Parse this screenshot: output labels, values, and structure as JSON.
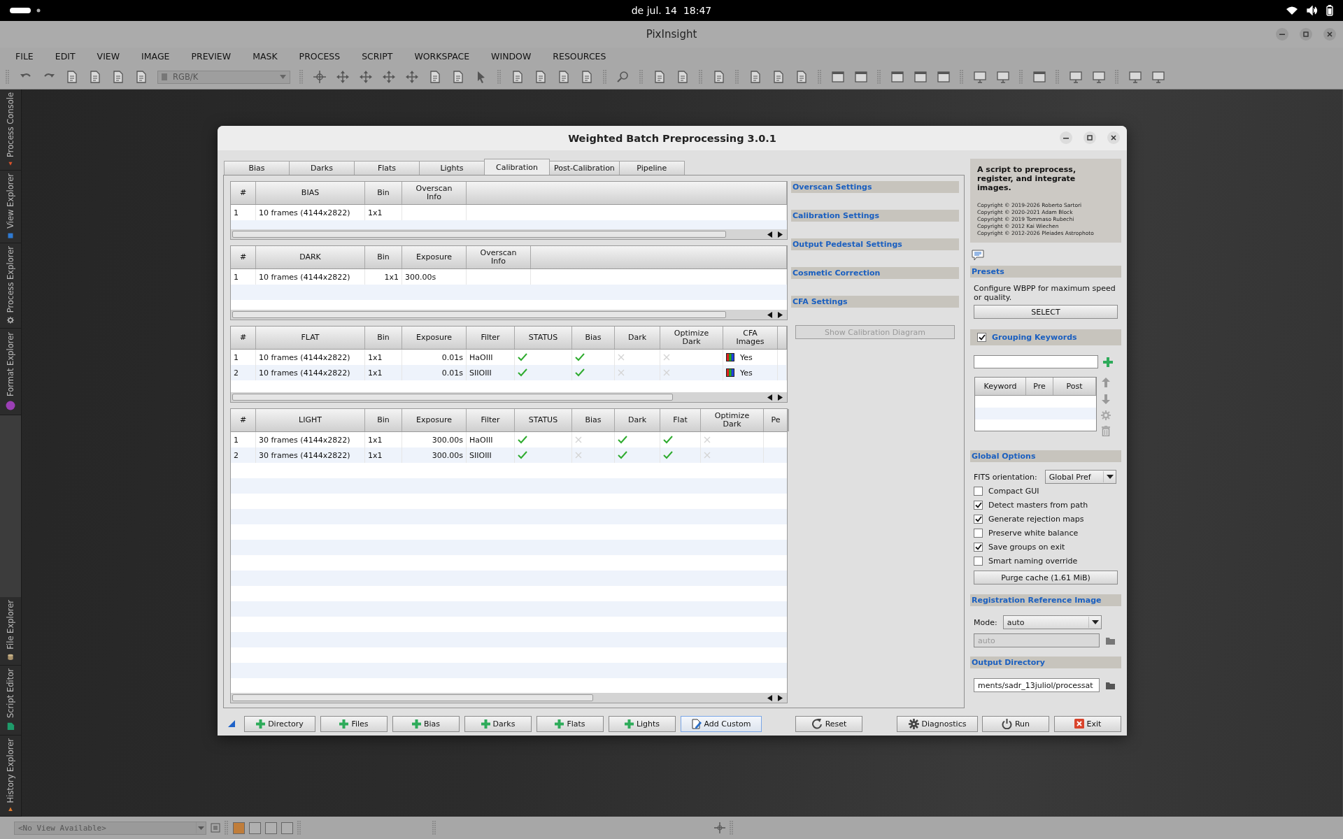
{
  "system_bar": {
    "clock": "de jul. 14  18:47"
  },
  "app": {
    "title": "PixInsight"
  },
  "menu": [
    {
      "label": "FILE"
    },
    {
      "label": "EDIT"
    },
    {
      "label": "VIEW"
    },
    {
      "label": "IMAGE"
    },
    {
      "label": "PREVIEW"
    },
    {
      "label": "MASK"
    },
    {
      "label": "PROCESS"
    },
    {
      "label": "SCRIPT"
    },
    {
      "label": "WORKSPACE"
    },
    {
      "label": "WINDOW"
    },
    {
      "label": "RESOURCES"
    }
  ],
  "toolbar": {
    "color_space": {
      "value": "RGB/K",
      "disabled": true
    }
  },
  "dock_tabs": [
    {
      "label": "Process Console"
    },
    {
      "label": "View Explorer"
    },
    {
      "label": "Process Explorer"
    },
    {
      "label": "Format Explorer"
    },
    {
      "label": "File Explorer"
    },
    {
      "label": "Script Editor"
    },
    {
      "label": "History Explorer"
    }
  ],
  "dialog": {
    "title": "Weighted Batch Preprocessing 3.0.1",
    "tabs": [
      {
        "label": "Bias",
        "selected": false
      },
      {
        "label": "Darks",
        "selected": false
      },
      {
        "label": "Flats",
        "selected": false
      },
      {
        "label": "Lights",
        "selected": false
      },
      {
        "label": "Calibration",
        "selected": true
      },
      {
        "label": "Post-Calibration",
        "selected": false
      },
      {
        "label": "Pipeline",
        "selected": false
      }
    ],
    "tables": [
      {
        "columns": [
          "#",
          "BIAS",
          "Bin",
          "Overscan Info"
        ],
        "rows": [
          [
            {
              "kind": "text",
              "text": "1"
            },
            {
              "kind": "text",
              "text": "10 frames (4144x2822)"
            },
            {
              "kind": "text",
              "text": "1x1"
            }
          ]
        ]
      },
      {
        "columns": [
          "#",
          "DARK",
          "Bin",
          "Exposure",
          "Overscan Info"
        ],
        "rows": [
          [
            {
              "kind": "text",
              "text": "1"
            },
            {
              "kind": "text",
              "text": "10 frames (4144x2822)"
            },
            {
              "kind": "number",
              "text": "1x1"
            },
            {
              "kind": "text",
              "text": "300.00s"
            }
          ]
        ]
      },
      {
        "columns": [
          "#",
          "FLAT",
          "Bin",
          "Exposure",
          "Filter",
          "STATUS",
          "Bias",
          "Dark",
          "Optimize Dark",
          "CFA Images"
        ],
        "rows": [
          [
            {
              "kind": "text",
              "text": "1"
            },
            {
              "kind": "text",
              "text": "10 frames (4144x2822)"
            },
            {
              "kind": "text",
              "text": "1x1"
            },
            {
              "kind": "number",
              "text": "0.01s"
            },
            {
              "kind": "text",
              "text": "HaOIII"
            },
            {
              "kind": "check",
              "checked": true
            },
            {
              "kind": "check",
              "checked": true
            },
            {
              "kind": "check",
              "checked": false
            },
            {
              "kind": "check",
              "checked": false
            },
            {
              "kind": "cfa",
              "text": "Yes"
            }
          ],
          [
            {
              "kind": "text",
              "text": "2"
            },
            {
              "kind": "text",
              "text": "10 frames (4144x2822)"
            },
            {
              "kind": "text",
              "text": "1x1"
            },
            {
              "kind": "number",
              "text": "0.01s"
            },
            {
              "kind": "text",
              "text": "SIIOIII"
            },
            {
              "kind": "check",
              "checked": true
            },
            {
              "kind": "check",
              "checked": true
            },
            {
              "kind": "check",
              "checked": false
            },
            {
              "kind": "check",
              "checked": false
            },
            {
              "kind": "cfa",
              "text": "Yes"
            }
          ]
        ]
      },
      {
        "columns": [
          "#",
          "LIGHT",
          "Bin",
          "Exposure",
          "Filter",
          "STATUS",
          "Bias",
          "Dark",
          "Flat",
          "Optimize Dark",
          "Pe"
        ],
        "rows": [
          [
            {
              "kind": "text",
              "text": "1"
            },
            {
              "kind": "text",
              "text": "30 frames (4144x2822)"
            },
            {
              "kind": "text",
              "text": "1x1"
            },
            {
              "kind": "number",
              "text": "300.00s"
            },
            {
              "kind": "text",
              "text": "HaOIII"
            },
            {
              "kind": "check",
              "checked": true
            },
            {
              "kind": "check",
              "checked": false
            },
            {
              "kind": "check",
              "checked": true
            },
            {
              "kind": "check",
              "checked": true
            },
            {
              "kind": "check",
              "checked": false
            }
          ],
          [
            {
              "kind": "text",
              "text": "2"
            },
            {
              "kind": "text",
              "text": "30 frames (4144x2822)"
            },
            {
              "kind": "text",
              "text": "1x1"
            },
            {
              "kind": "number",
              "text": "300.00s"
            },
            {
              "kind": "text",
              "text": "SIIOIII"
            },
            {
              "kind": "check",
              "checked": true
            },
            {
              "kind": "check",
              "checked": false
            },
            {
              "kind": "check",
              "checked": true
            },
            {
              "kind": "check",
              "checked": true
            },
            {
              "kind": "check",
              "checked": false
            }
          ]
        ]
      }
    ],
    "sections": [
      "Overscan Settings",
      "Calibration Settings",
      "Output Pedestal Settings",
      "Cosmetic Correction",
      "CFA Settings"
    ],
    "diagram_button": {
      "label": "Show Calibration Diagram",
      "disabled": true
    },
    "about": {
      "heading": "A script to preprocess, register, and integrate images.",
      "copyrights": [
        "Copyright © 2019-2026 Roberto Sartori",
        "Copyright © 2020-2021 Adam Block",
        "Copyright © 2019 Tommaso Rubechi",
        "Copyright © 2012 Kai Wiechen",
        "Copyright © 2012-2026 Pleiades Astrophoto"
      ]
    },
    "presets": {
      "title": "Presets",
      "text": "Configure WBPP for maximum speed or quality.",
      "button": "SELECT"
    },
    "grouping_keywords": {
      "title": "Grouping Keywords",
      "checked": true,
      "columns": [
        "Keyword",
        "Pre",
        "Post"
      ]
    },
    "global_options": {
      "title": "Global Options",
      "fits_label": "FITS orientation:",
      "fits_value": "Global Pref",
      "options": [
        {
          "label": "Compact GUI",
          "checked": false
        },
        {
          "label": "Detect masters from path",
          "checked": true
        },
        {
          "label": "Generate rejection maps",
          "checked": true
        },
        {
          "label": "Preserve white balance",
          "checked": false
        },
        {
          "label": "Save groups on exit",
          "checked": true
        },
        {
          "label": "Smart naming override",
          "checked": false
        }
      ],
      "purge_button": "Purge cache (1.61 MiB)"
    },
    "registration": {
      "title": "Registration Reference Image",
      "mode_label": "Mode:",
      "mode_value": "auto",
      "reference": {
        "value": "auto",
        "disabled": true
      }
    },
    "output": {
      "title": "Output Directory",
      "path": "ments/sadr_13juliol/processat"
    },
    "add_buttons": [
      {
        "label": "Directory",
        "kind": "add",
        "focused": false
      },
      {
        "label": "Files",
        "kind": "add",
        "focused": false
      },
      {
        "label": "Bias",
        "kind": "add",
        "focused": false
      },
      {
        "label": "Darks",
        "kind": "add",
        "focused": false
      },
      {
        "label": "Flats",
        "kind": "add",
        "focused": false
      },
      {
        "label": "Lights",
        "kind": "add",
        "focused": false
      },
      {
        "label": "Add Custom",
        "kind": "custom",
        "focused": true
      }
    ],
    "action_buttons": [
      {
        "label": "Reset",
        "kind": "reset"
      },
      {
        "label": "Diagnostics",
        "kind": "diagnostics"
      },
      {
        "label": "Run",
        "kind": "run"
      },
      {
        "label": "Exit",
        "kind": "exit"
      }
    ]
  },
  "status_bar": {
    "view_selector": {
      "value": "<No View Available>"
    }
  }
}
